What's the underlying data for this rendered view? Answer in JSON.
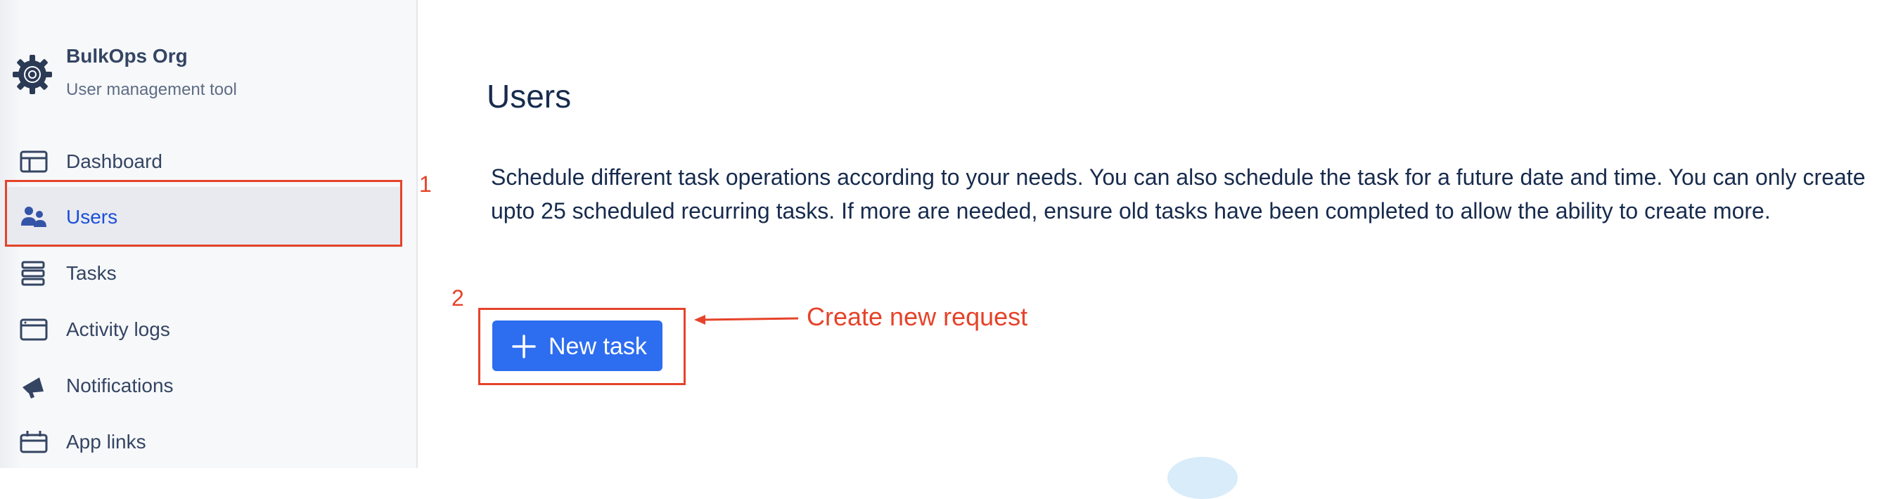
{
  "org": {
    "name": "BulkOps Org",
    "subtitle": "User management tool"
  },
  "sidebar": {
    "items": [
      {
        "label": "Dashboard",
        "icon": "dashboard-icon",
        "active": false
      },
      {
        "label": "Users",
        "icon": "users-icon",
        "active": true
      },
      {
        "label": "Tasks",
        "icon": "tasks-icon",
        "active": false
      },
      {
        "label": "Activity logs",
        "icon": "activity-logs-icon",
        "active": false
      },
      {
        "label": "Notifications",
        "icon": "megaphone-icon",
        "active": false
      },
      {
        "label": "App links",
        "icon": "app-links-icon",
        "active": false
      }
    ]
  },
  "main": {
    "title": "Users",
    "description": "Schedule different task operations according to your needs. You can also schedule the task for a future date and time. You can only create upto 25 scheduled recurring tasks. If more are needed, ensure old tasks have been completed to allow the ability to create more.",
    "new_task_label": "New task"
  },
  "annotations": {
    "step1": "1",
    "step2": "2",
    "callout": "Create new request",
    "color": "#e5432a"
  },
  "colors": {
    "primary_button": "#2d6df0",
    "active_nav_text": "#1d4ed8",
    "annotation": "#e5432a"
  }
}
